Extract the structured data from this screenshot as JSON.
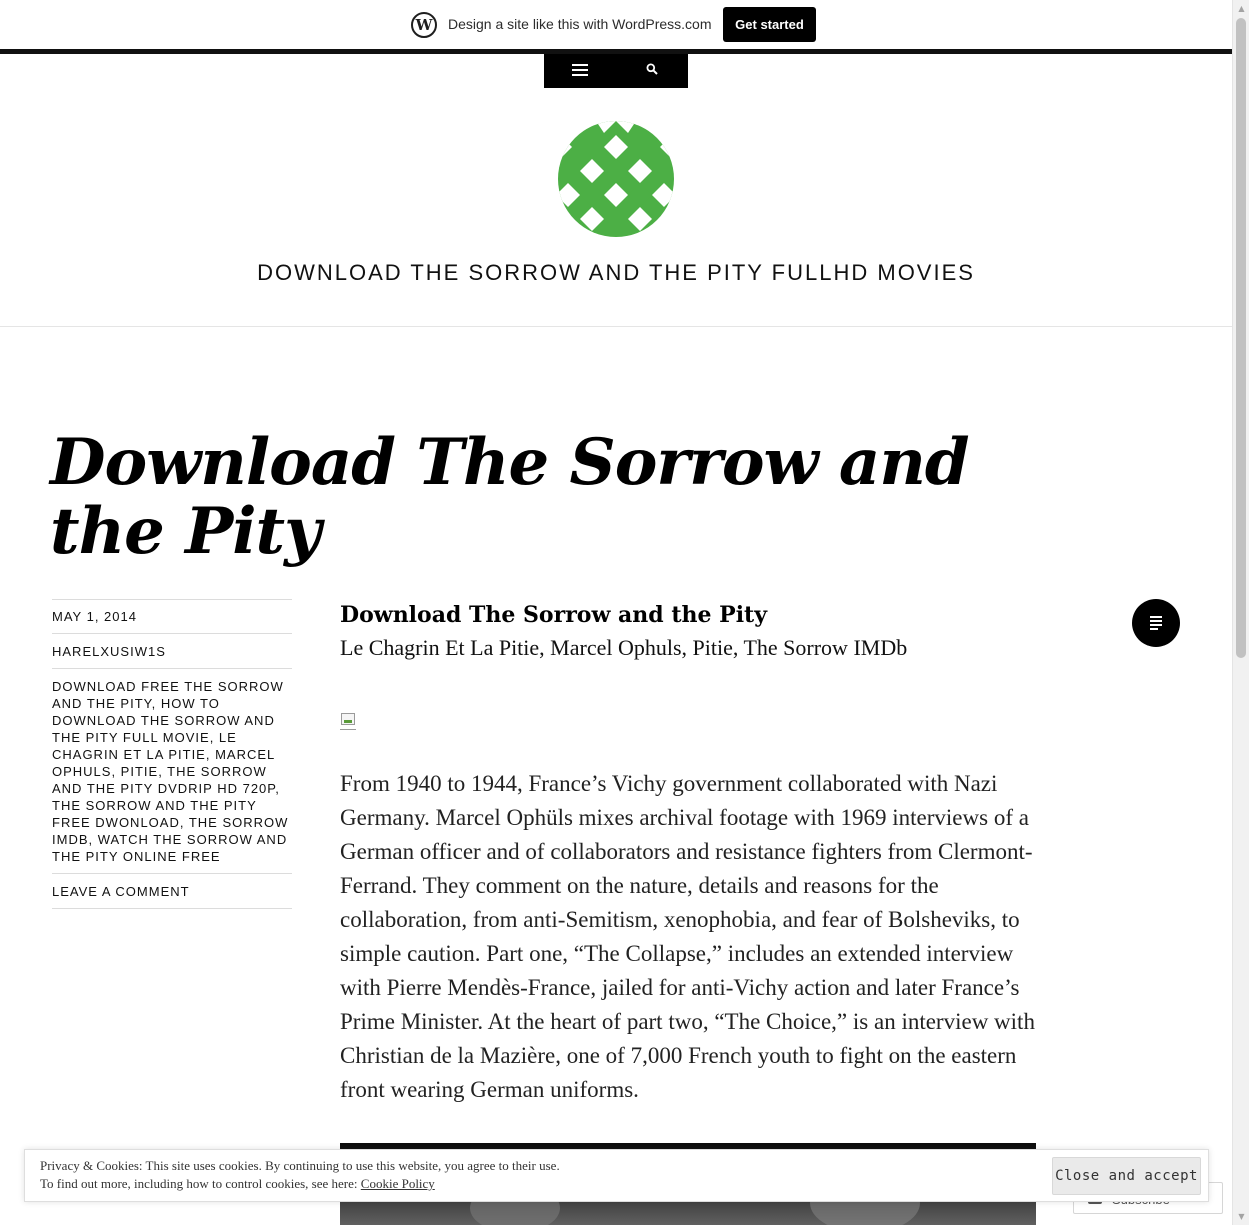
{
  "wp_banner": {
    "text": "Design a site like this with WordPress.com",
    "cta": "Get started"
  },
  "nav": {
    "menu_icon": "menu-icon",
    "search_icon": "search-icon"
  },
  "site": {
    "title": "DOWNLOAD THE SORROW AND THE PITY FULLHD MOVIES",
    "logo_color": "#4caf45"
  },
  "post": {
    "title": "Download The Sorrow and the Pity",
    "meta": {
      "date": "MAY 1, 2014",
      "author": "HARELXUSIW1S",
      "tags": "DOWNLOAD FREE THE SORROW AND THE PITY, HOW TO DOWNLOAD THE SORROW AND THE PITY FULL MOVIE, LE CHAGRIN ET LA PITIE, MARCEL OPHULS, PITIE, THE SORROW AND THE PITY DVDRIP HD 720P, THE SORROW AND THE PITY FREE DWONLOAD, THE SORROW IMDB, WATCH THE SORROW AND THE PITY ONLINE FREE",
      "comment_link": "LEAVE A COMMENT"
    },
    "content_heading": "Download The Sorrow and the Pity",
    "content_subheading": "Le Chagrin Et La Pitie, Marcel Ophuls, Pitie, The Sorrow IMDb",
    "body": "From 1940 to 1944, France’s Vichy government collaborated with Nazi Germany. Marcel Ophüls mixes archival footage with 1969 interviews of a German officer and of collaborators and resistance fighters from Clermont-Ferrand. They comment on the nature, details and reasons for the collaboration, from anti-Semitism, xenophobia, and fear of Bolsheviks, to simple caution. Part one, “The Collapse,” includes an extended interview with Pierre Mendès-France, jailed for anti-Vichy action and later France’s Prime Minister. At the heart of part two, “The Choice,” is an interview with Christian de la Mazière, one of 7,000 French youth to fight on the eastern front wearing German uniforms.",
    "format_icon": "standard-post-format-icon"
  },
  "cookie_bar": {
    "line1": "Privacy & Cookies: This site uses cookies. By continuing to use this website, you agree to their use.",
    "line2_prefix": "To find out more, including how to control cookies, see here: ",
    "policy_link": "Cookie Policy",
    "close_button": "Close and accept"
  },
  "subscribe": {
    "label": "Subscribe"
  }
}
